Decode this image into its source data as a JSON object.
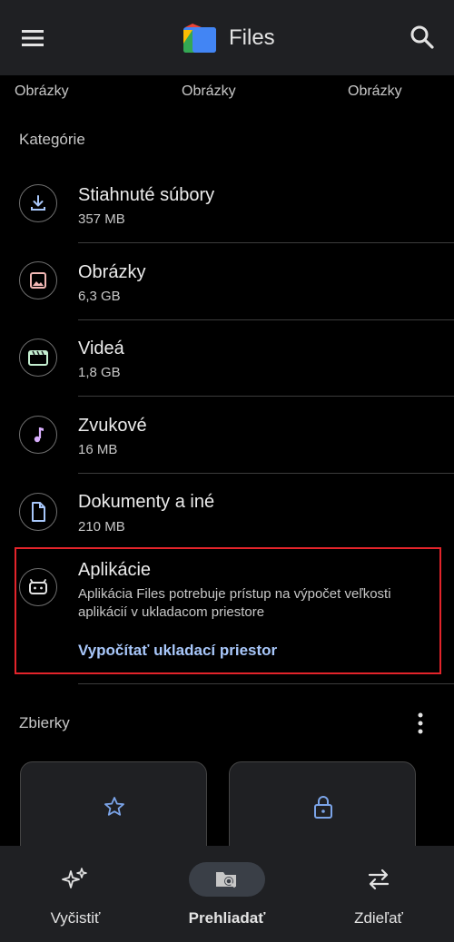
{
  "app": {
    "title": "Files"
  },
  "thumbs": {
    "labels": [
      "Obrázky",
      "Obrázky",
      "Obrázky"
    ]
  },
  "categories_section": {
    "title": "Kategórie"
  },
  "categories": [
    {
      "name": "Stiahnuté súbory",
      "size": "357 MB",
      "icon": "download-icon",
      "color": "#a8c7fa"
    },
    {
      "name": "Obrázky",
      "size": "6,3 GB",
      "icon": "image-icon",
      "color": "#f2b8b5"
    },
    {
      "name": "Videá",
      "size": "1,8 GB",
      "icon": "video-icon",
      "color": "#c4eed0"
    },
    {
      "name": "Zvukové",
      "size": "16 MB",
      "icon": "music-note-icon",
      "color": "#d7aefb"
    },
    {
      "name": "Dokumenty a iné",
      "size": "210 MB",
      "icon": "document-icon",
      "color": "#a8c7fa"
    }
  ],
  "apps": {
    "name": "Aplikácie",
    "description": "Aplikácia Files potrebuje prístup na výpočet veľkosti aplikácií v ukladacom priestore",
    "action": "Vypočítať ukladací priestor",
    "icon": "android-icon"
  },
  "collections": {
    "title": "Zbierky"
  },
  "bottom_nav": [
    {
      "label": "Vyčistiť",
      "icon": "sparkle-icon",
      "active": false
    },
    {
      "label": "Prehliadať",
      "icon": "browse-icon",
      "active": true
    },
    {
      "label": "Zdieľať",
      "icon": "swap-icon",
      "active": false
    }
  ],
  "colors": {
    "accent": "#a8c7fa",
    "highlight_border": "#e3242b",
    "surface": "#1f2023"
  }
}
